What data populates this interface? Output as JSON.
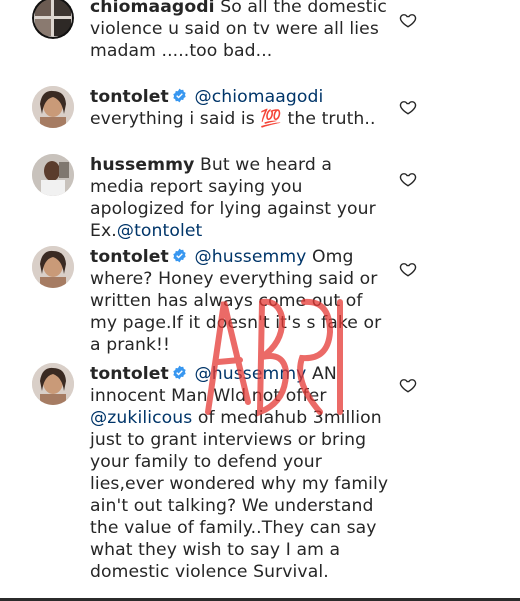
{
  "comments": [
    {
      "username": "chiomaagodi",
      "verified": false,
      "mention": "",
      "text": "So all the domestic violence u said on tv were all lies madam .....too bad...",
      "avatar_icon": "avatar-icon"
    },
    {
      "username": "tontolet",
      "verified": true,
      "mention": "@chiomaagodi",
      "text_before_emoji": "everything i said is",
      "emoji": "💯",
      "text_after_emoji": "the truth..",
      "avatar_icon": "avatar-icon"
    },
    {
      "username": "hussemmy",
      "verified": false,
      "text": "But we heard a media report saying you apologized for lying against your Ex.",
      "mention_end": "@tontolet",
      "avatar_icon": "avatar-icon"
    },
    {
      "username": "tontolet",
      "verified": true,
      "mention": "@hussemmy",
      "text": "Omg where? Honey everything said or written has always come out of my page.If it doesn't it's s fake or a prank!!",
      "avatar_icon": "avatar-icon"
    },
    {
      "username": "tontolet",
      "verified": true,
      "mention": "@hussemmy",
      "text_a": "AN innocent Man Wld not offer",
      "mention_mid": "@zukilicous",
      "text_b": "of mediahub 3million just to grant interviews or bring your family to defend your lies,ever wondered why my family ain't out talking? We understand the value of family..They can say what they wish to say I am a domestic violence Survival.",
      "avatar_icon": "avatar-icon"
    }
  ],
  "colors": {
    "text": "#262626",
    "mention": "#003569",
    "verified": "#3897f0",
    "watermark": "#e53935"
  }
}
